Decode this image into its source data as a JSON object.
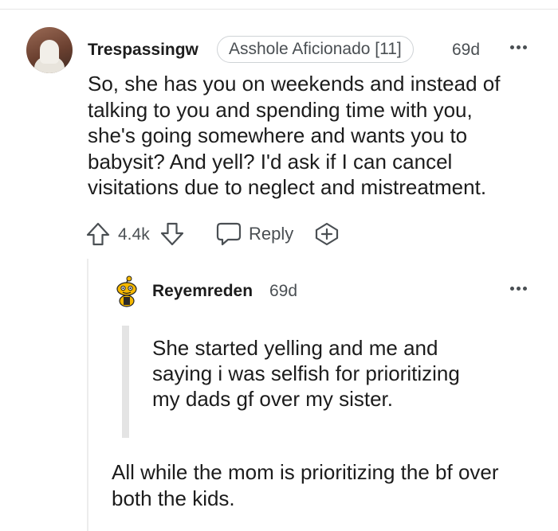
{
  "parent_comment": {
    "username": "Trespassingw",
    "flair": "Asshole Aficionado [11]",
    "time": "69d",
    "body_lines": [
      "So, she has you on weekends and instead of",
      "talking to you and spending time with you,",
      "she's going somewhere and wants you to",
      "babysit? And yell? I'd ask if I can cancel",
      "visitations due to neglect and mistreatment."
    ],
    "score": "4.4k",
    "reply_label": "Reply",
    "icons": {
      "upvote": "arrow-up-icon",
      "downvote": "arrow-down-icon",
      "reply": "speech-bubble-icon",
      "award": "award-plus-icon",
      "more": "ellipsis-icon"
    }
  },
  "reply_comment": {
    "username": "Reyemreden",
    "time": "69d",
    "quote_lines": [
      "She started yelling and me and",
      "saying i was selfish for prioritizing",
      "my dads gf over my sister."
    ],
    "body_lines": [
      "All while the mom is prioritizing the bf over",
      "both the kids."
    ]
  },
  "colors": {
    "text": "#1c1c1c",
    "meta": "#4a4f53",
    "flair_border": "#cfd3d6",
    "quote_bar": "#e4e4e4"
  }
}
